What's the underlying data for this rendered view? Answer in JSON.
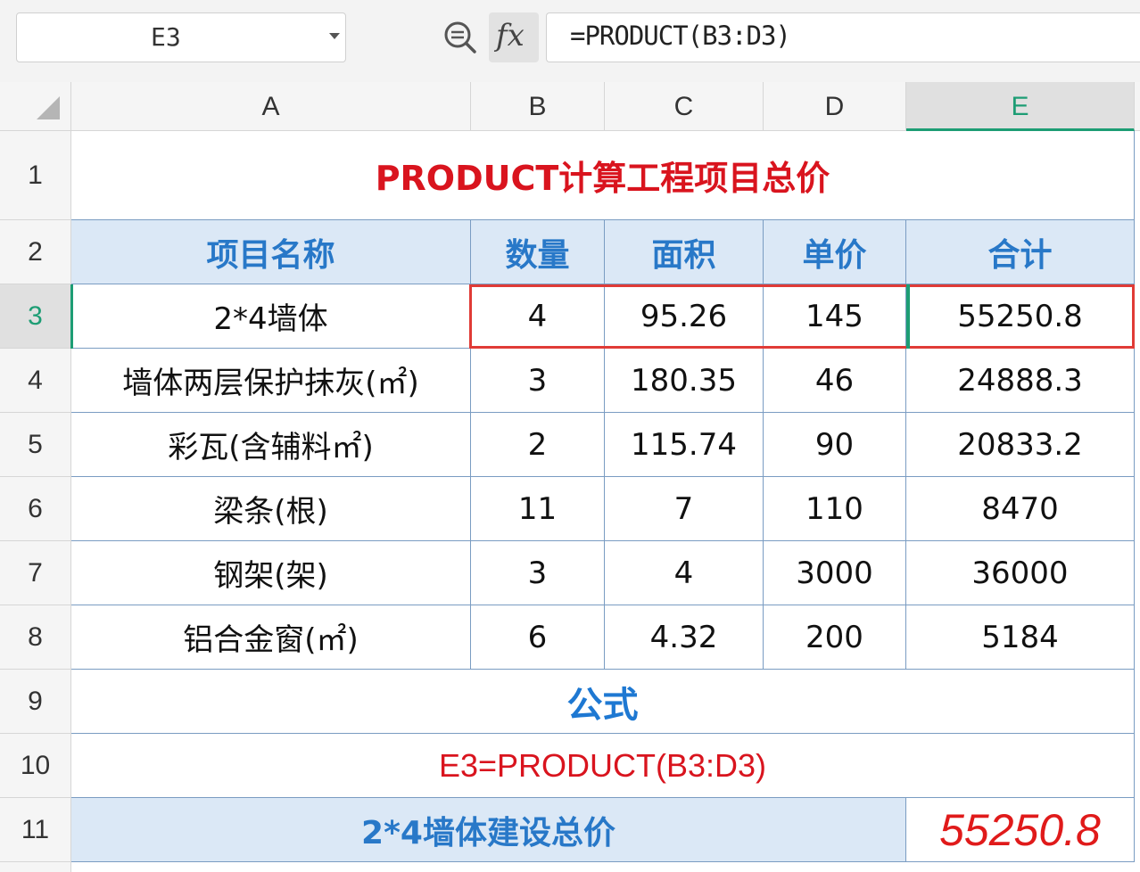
{
  "formula_bar": {
    "name_box": "E3",
    "fx_label": "fx",
    "formula": "=PRODUCT(B3:D3)"
  },
  "columns": [
    "A",
    "B",
    "C",
    "D",
    "E"
  ],
  "rows": [
    "1",
    "2",
    "3",
    "4",
    "5",
    "6",
    "7",
    "8",
    "9",
    "10",
    "11"
  ],
  "sheet": {
    "title": "PRODUCT计算工程项目总价",
    "headers": [
      "项目名称",
      "数量",
      "面积",
      "单价",
      "合计"
    ],
    "data": [
      [
        "2*4墙体",
        "4",
        "95.26",
        "145",
        "55250.8"
      ],
      [
        "墙体两层保护抹灰(㎡)",
        "3",
        "180.35",
        "46",
        "24888.3"
      ],
      [
        "彩瓦(含辅料㎡)",
        "2",
        "115.74",
        "90",
        "20833.2"
      ],
      [
        "梁条(根)",
        "11",
        "7",
        "110",
        "8470"
      ],
      [
        "钢架(架)",
        "3",
        "4",
        "3000",
        "36000"
      ],
      [
        "铝合金窗(㎡)",
        "6",
        "4.32",
        "200",
        "5184"
      ]
    ],
    "formula_title": "公式",
    "formula_text": "E3=PRODUCT(B3:D3)",
    "total_label": "2*4墙体建设总价",
    "total_value": "55250.8"
  },
  "colors": {
    "accent_green": "#1d9d74",
    "header_blue": "#2878c8",
    "header_bg": "#dbe8f6",
    "title_red": "#d9141e",
    "highlight_red": "#e03b36"
  },
  "icons": {
    "zoom": "zoom-out-icon",
    "dropdown": "chevron-down-icon"
  }
}
